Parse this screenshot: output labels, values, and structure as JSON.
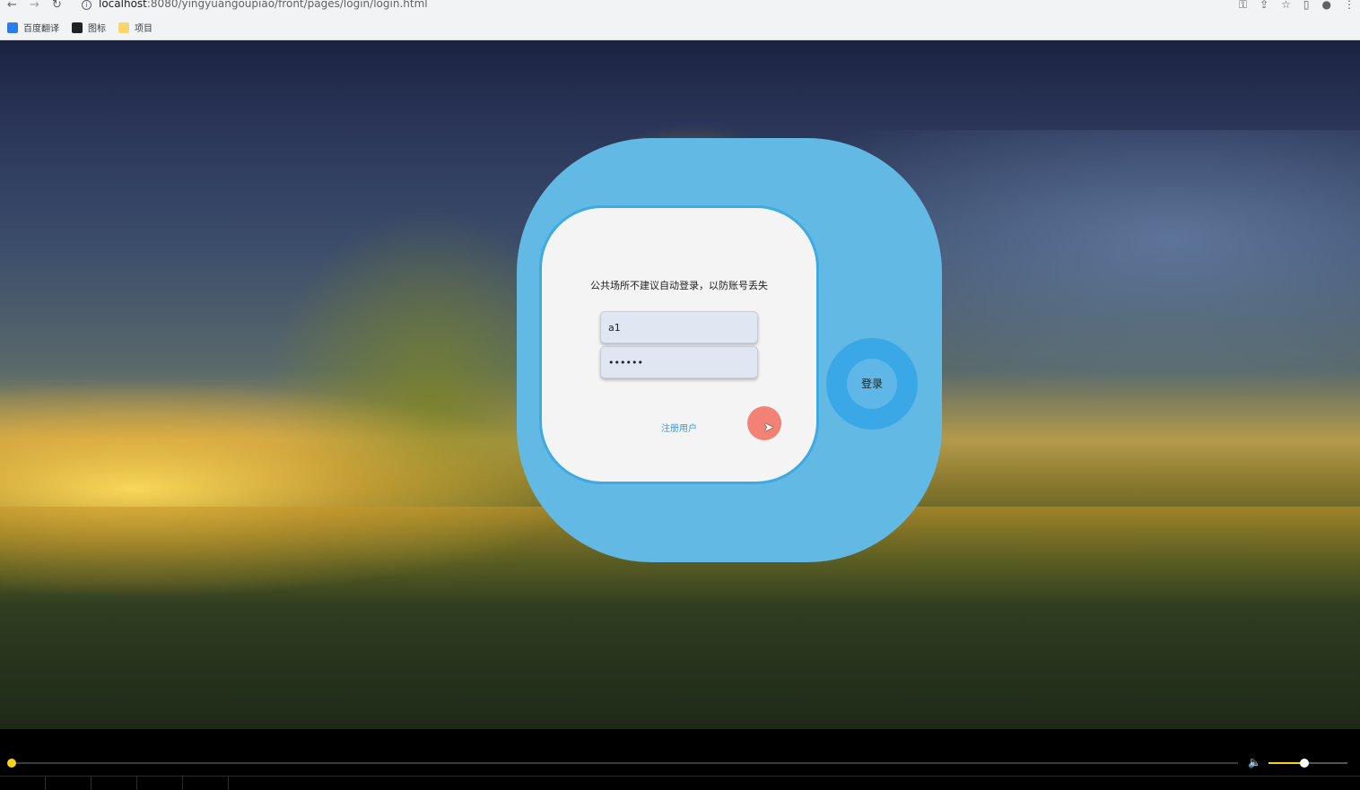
{
  "browser": {
    "url_host": "localhost",
    "url_path": ":8080/yingyuangoupiao/front/pages/login/login.html",
    "bookmarks": [
      {
        "label": "百度翻译",
        "color": "#2b7de9"
      },
      {
        "label": "图标",
        "color": "#202124"
      },
      {
        "label": "项目",
        "color": "#f9d56b"
      }
    ]
  },
  "login": {
    "notice": "公共场所不建议自动登录，以防账号丢失",
    "username_value": "a1",
    "password_value": "••••••",
    "register_label": "注册用户",
    "login_label": "登录"
  },
  "player": {
    "progress": 0.0,
    "volume": 0.45,
    "accent_color": "#f6d318"
  }
}
